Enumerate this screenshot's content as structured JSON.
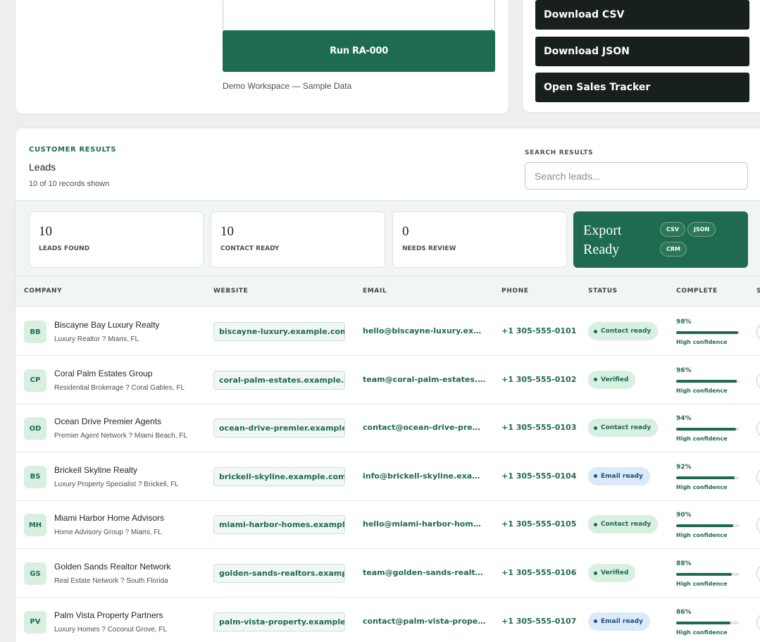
{
  "workspace": {
    "run_label": "Run RA-000",
    "note": "Demo Workspace — Sample Data"
  },
  "actions": {
    "download_csv": "Download CSV",
    "download_json": "Download JSON",
    "open_tracker": "Open Sales Tracker"
  },
  "results": {
    "eyebrow": "CUSTOMER RESULTS",
    "title": "Leads",
    "count": "10 of 10 records shown",
    "search_label": "SEARCH RESULTS",
    "search_placeholder": "Search leads..."
  },
  "stats": [
    {
      "value": "10",
      "label": "LEADS FOUND"
    },
    {
      "value": "10",
      "label": "CONTACT READY"
    },
    {
      "value": "0",
      "label": "NEEDS REVIEW"
    }
  ],
  "export": {
    "title": "Export Ready",
    "chips": [
      "CSV",
      "JSON",
      "CRM"
    ]
  },
  "table": {
    "headers": [
      "COMPANY",
      "WEBSITE",
      "EMAIL",
      "PHONE",
      "STATUS",
      "COMPLETE",
      "S"
    ],
    "rows": [
      {
        "initials": "BB",
        "company": "Biscayne Bay Luxury Realty",
        "subtitle": "Luxury Realtor ? Miami, FL",
        "website": "biscayne-luxury.example.com",
        "email": "hello@biscayne-luxury.example.com",
        "phone": "+1 305-555-0101",
        "status": "Contact ready",
        "status_kind": "green",
        "complete": 98,
        "complete_label": "98%",
        "confidence": "High confidence"
      },
      {
        "initials": "CP",
        "company": "Coral Palm Estates Group",
        "subtitle": "Residential Brokerage ? Coral Gables, FL",
        "website": "coral-palm-estates.example.com",
        "email": "team@coral-palm-estates.example.com",
        "phone": "+1 305-555-0102",
        "status": "Verified",
        "status_kind": "green",
        "complete": 96,
        "complete_label": "96%",
        "confidence": "High confidence"
      },
      {
        "initials": "OD",
        "company": "Ocean Drive Premier Agents",
        "subtitle": "Premier Agent Network ? Miami Beach, FL",
        "website": "ocean-drive-premier.example.com",
        "email": "contact@ocean-drive-premier.example.com",
        "phone": "+1 305-555-0103",
        "status": "Contact ready",
        "status_kind": "green",
        "complete": 94,
        "complete_label": "94%",
        "confidence": "High confidence"
      },
      {
        "initials": "BS",
        "company": "Brickell Skyline Realty",
        "subtitle": "Luxury Property Specialist ? Brickell, FL",
        "website": "brickell-skyline.example.com",
        "email": "info@brickell-skyline.example.com",
        "phone": "+1 305-555-0104",
        "status": "Email ready",
        "status_kind": "blue",
        "complete": 92,
        "complete_label": "92%",
        "confidence": "High confidence"
      },
      {
        "initials": "MH",
        "company": "Miami Harbor Home Advisors",
        "subtitle": "Home Advisory Group ? Miami, FL",
        "website": "miami-harbor-homes.example.com",
        "email": "hello@miami-harbor-homes.example.com",
        "phone": "+1 305-555-0105",
        "status": "Contact ready",
        "status_kind": "green",
        "complete": 90,
        "complete_label": "90%",
        "confidence": "High confidence"
      },
      {
        "initials": "GS",
        "company": "Golden Sands Realtor Network",
        "subtitle": "Real Estate Network ? South Florida",
        "website": "golden-sands-realtors.example.com",
        "email": "team@golden-sands-realtors.example.com",
        "phone": "+1 305-555-0106",
        "status": "Verified",
        "status_kind": "green",
        "complete": 88,
        "complete_label": "88%",
        "confidence": "High confidence"
      },
      {
        "initials": "PV",
        "company": "Palm Vista Property Partners",
        "subtitle": "Luxury Homes ? Coconut Grove, FL",
        "website": "palm-vista-property.example.com",
        "email": "contact@palm-vista-property.example.com",
        "phone": "+1 305-555-0107",
        "status": "Email ready",
        "status_kind": "blue",
        "complete": 86,
        "complete_label": "86%",
        "confidence": "High confidence"
      }
    ]
  }
}
